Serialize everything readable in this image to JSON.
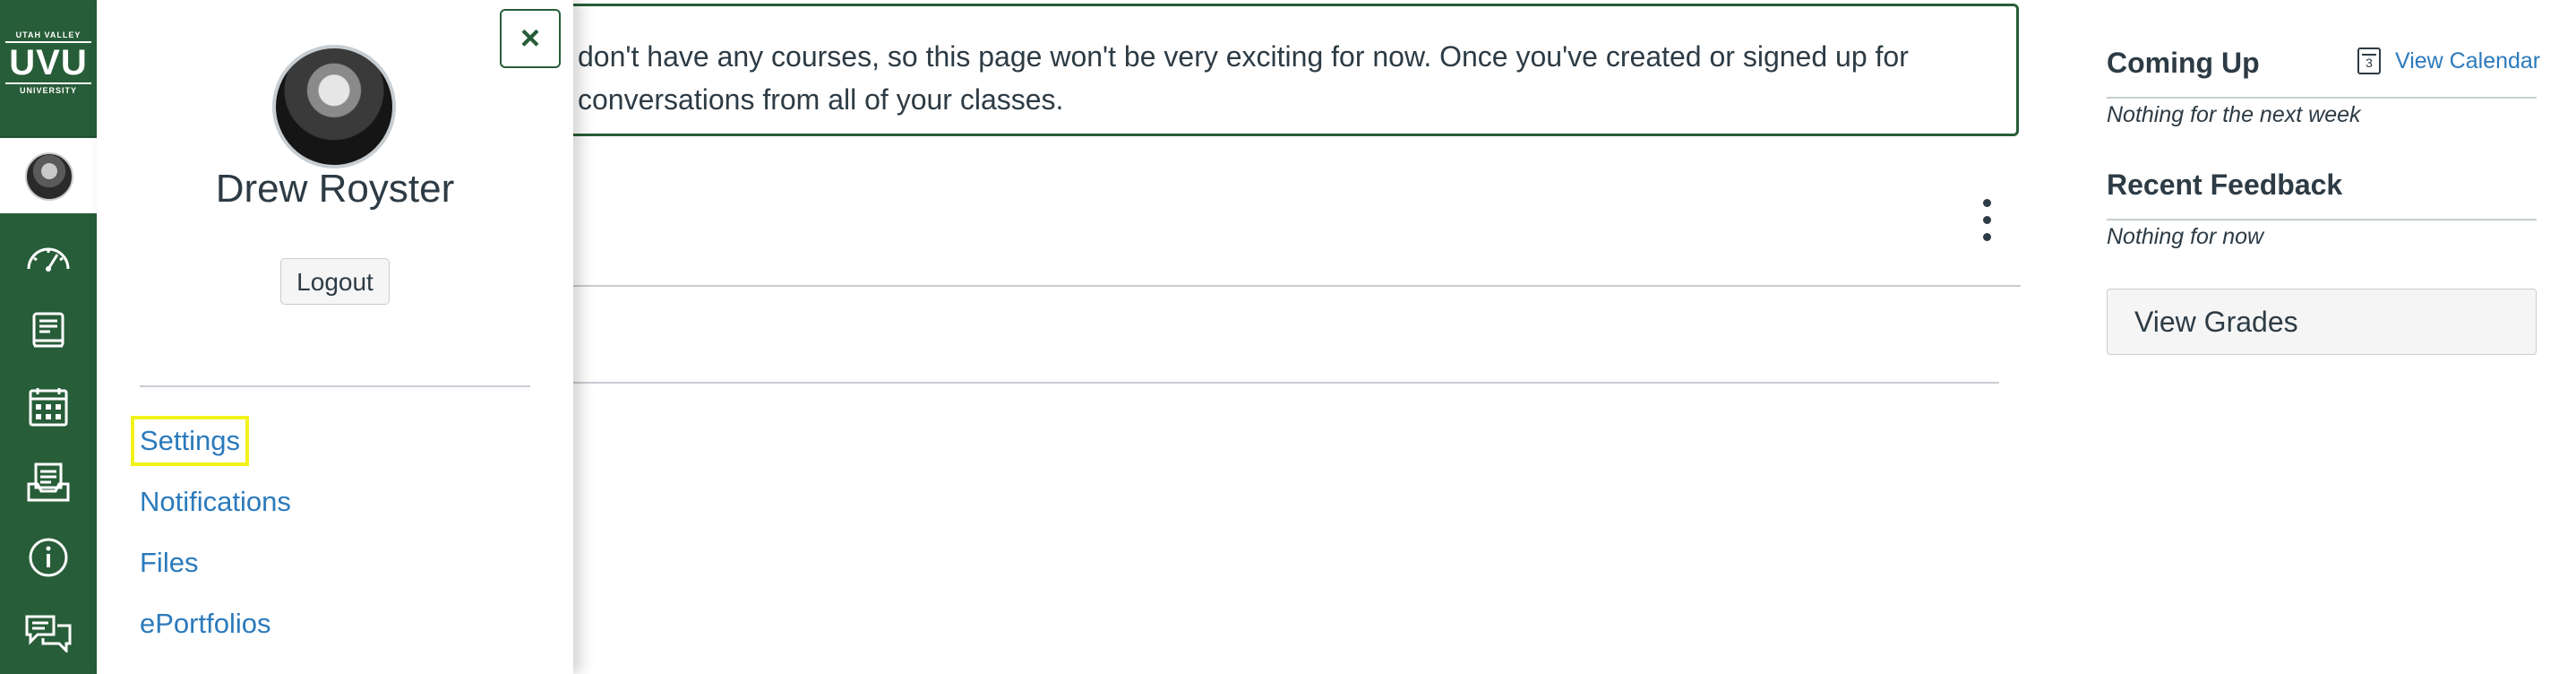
{
  "global_nav": {
    "logo": {
      "top": "UTAH VALLEY",
      "mid": "UVU",
      "bottom": "UNIVERSITY"
    },
    "items": [
      {
        "name": "account",
        "icon": "avatar"
      },
      {
        "name": "dashboard",
        "icon": "speedometer-icon"
      },
      {
        "name": "courses",
        "icon": "book-icon"
      },
      {
        "name": "calendar",
        "icon": "calendar-grid-icon"
      },
      {
        "name": "inbox",
        "icon": "inbox-tray-icon"
      },
      {
        "name": "help",
        "icon": "info-circle-icon"
      },
      {
        "name": "commons",
        "icon": "chat-bubbles-icon"
      }
    ],
    "colors": {
      "background": "#275d38"
    }
  },
  "account_tray": {
    "user_name": "Drew Royster",
    "logout_label": "Logout",
    "close_glyph": "×",
    "links": [
      {
        "label": "Settings",
        "highlighted": true
      },
      {
        "label": "Notifications",
        "highlighted": false
      },
      {
        "label": "Files",
        "highlighted": false
      },
      {
        "label": "ePortfolios",
        "highlighted": false
      }
    ]
  },
  "main": {
    "notice_line1": "don't have any courses, so this page won't be very exciting for now. Once you've created or signed up for",
    "notice_line2": "conversations from all of your classes."
  },
  "right_sidebar": {
    "coming_up": {
      "heading": "Coming Up",
      "view_calendar_label": "View Calendar",
      "calendar_icon_day": "3",
      "empty": "Nothing for the next week"
    },
    "recent_feedback": {
      "heading": "Recent Feedback",
      "empty": "Nothing for now"
    },
    "view_grades_label": "View Grades"
  },
  "colors": {
    "brand": "#275d38",
    "link": "#2b7abc",
    "highlight": "#f2f21b",
    "text": "#2d3b45"
  }
}
